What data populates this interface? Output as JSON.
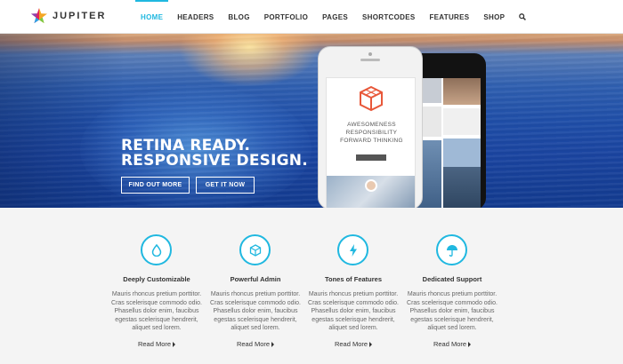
{
  "brand": {
    "name": "JUPITER",
    "logo_icon": "star-logo-icon"
  },
  "nav": {
    "items": [
      {
        "label": "HOME",
        "active": true
      },
      {
        "label": "HEADERS"
      },
      {
        "label": "BLOG"
      },
      {
        "label": "PORTFOLIO"
      },
      {
        "label": "PAGES"
      },
      {
        "label": "SHORTCODES"
      },
      {
        "label": "FEATURES"
      },
      {
        "label": "SHOP"
      }
    ],
    "search_icon": "search-icon"
  },
  "hero": {
    "headline_line1": "RETINA READY.",
    "headline_line2": "RESPONSIVE DESIGN.",
    "button_primary": "FIND OUT MORE",
    "button_secondary": "GET IT NOW",
    "phone_screen": {
      "line1": "AWESOMENESS",
      "line2": "RESPONSIBILITY",
      "line3": "FORWARD THINKING"
    }
  },
  "features": [
    {
      "icon": "water-drop-icon",
      "title": "Deeply Customizable",
      "text": "Mauris rhoncus pretium porttitor. Cras scelerisque commodo odio. Phasellus dolor enim, faucibus egestas scelerisque hendrerit, aliquet sed lorem.",
      "link": "Read More"
    },
    {
      "icon": "cube-icon",
      "title": "Powerful Admin",
      "text": "Mauris rhoncus pretium porttitor. Cras scelerisque commodo odio. Phasellus dolor enim, faucibus egestas scelerisque hendrerit, aliquet sed lorem.",
      "link": "Read More"
    },
    {
      "icon": "lightning-icon",
      "title": "Tones of Features",
      "text": "Mauris rhoncus pretium porttitor. Cras scelerisque commodo odio. Phasellus dolor enim, faucibus egestas scelerisque hendrerit, aliquet sed lorem.",
      "link": "Read More"
    },
    {
      "icon": "umbrella-icon",
      "title": "Dedicated Support",
      "text": "Mauris rhoncus pretium porttitor. Cras scelerisque commodo odio. Phasellus dolor enim, faucibus egestas scelerisque hendrerit, aliquet sed lorem.",
      "link": "Read More"
    }
  ],
  "colors": {
    "accent": "#20b8e0",
    "text": "#333333",
    "muted": "#666666",
    "background": "#f4f4f4"
  }
}
